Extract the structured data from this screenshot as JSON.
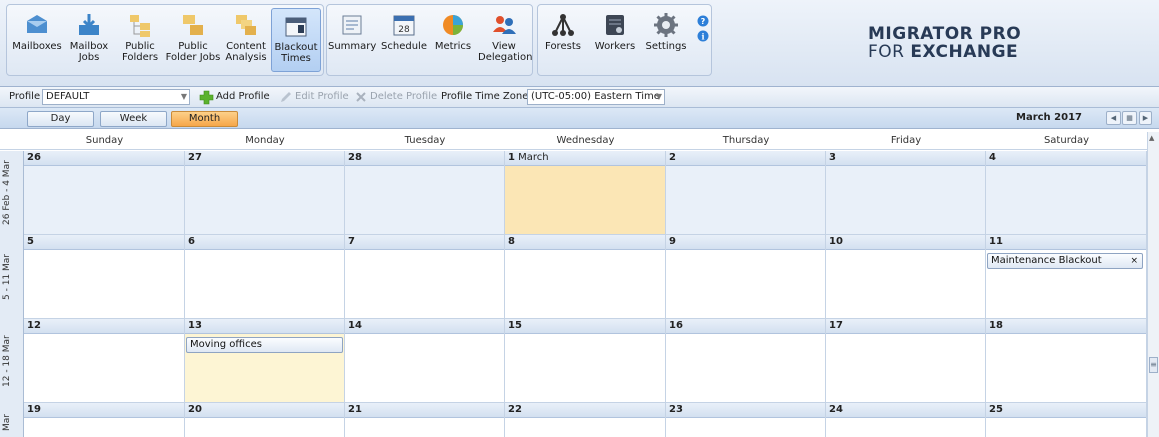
{
  "ribbon": {
    "buttons": [
      {
        "label": "Mailboxes",
        "icon": "mailboxes-icon"
      },
      {
        "label": "Mailbox Jobs",
        "icon": "mailbox-jobs-icon"
      },
      {
        "label": "Public Folders",
        "icon": "public-folders-icon"
      },
      {
        "label": "Public Folder Jobs",
        "icon": "public-folder-jobs-icon"
      },
      {
        "label": "Content Analysis",
        "icon": "content-analysis-icon"
      },
      {
        "label": "Blackout Times",
        "icon": "blackout-times-icon"
      },
      {
        "label": "Summary",
        "icon": "summary-icon"
      },
      {
        "label": "Schedule",
        "icon": "schedule-icon"
      },
      {
        "label": "Metrics",
        "icon": "metrics-icon"
      },
      {
        "label": "View Delegation",
        "icon": "view-delegation-icon"
      },
      {
        "label": "Forests",
        "icon": "forests-icon"
      },
      {
        "label": "Workers",
        "icon": "workers-icon"
      },
      {
        "label": "Settings",
        "icon": "settings-icon"
      }
    ],
    "schedule_day": "28",
    "active_button": "Blackout Times"
  },
  "logo": {
    "line1": "MIGRATOR PRO",
    "line2_a": "FOR ",
    "line2_b": "EXCHANGE"
  },
  "profile_bar": {
    "profile_label": "Profile",
    "profile_value": "DEFAULT",
    "add_label": "Add Profile",
    "edit_label": "Edit Profile",
    "delete_label": "Delete Profile",
    "tz_label": "Profile Time Zone",
    "tz_value": "(UTC-05:00) Eastern Time"
  },
  "view_bar": {
    "day": "Day",
    "week": "Week",
    "month": "Month",
    "active": "Month",
    "current_month": "March 2017"
  },
  "calendar": {
    "weekdays": [
      "Sunday",
      "Monday",
      "Tuesday",
      "Wednesday",
      "Thursday",
      "Friday",
      "Saturday"
    ],
    "weeks": [
      {
        "label": "26 Feb - 4 Mar",
        "days": [
          "26",
          "27",
          "28",
          "1",
          "2",
          "3",
          "4"
        ]
      },
      {
        "label": "5 - 11 Mar",
        "days": [
          "5",
          "6",
          "7",
          "8",
          "9",
          "10",
          "11"
        ]
      },
      {
        "label": "12 - 18 Mar",
        "days": [
          "12",
          "13",
          "14",
          "15",
          "16",
          "17",
          "18"
        ]
      },
      {
        "label": "Mar",
        "days": [
          "19",
          "20",
          "21",
          "22",
          "23",
          "24",
          "25"
        ]
      }
    ],
    "march_first_suffix": "March",
    "appointments": [
      {
        "title": "Maintenance Blackout",
        "close": "×"
      },
      {
        "title": "Moving offices"
      }
    ]
  },
  "colors": {
    "today_highlight": "#fbe6b5",
    "selected_highlight": "#fdf5d4",
    "accent_orange": "#f6a64a"
  }
}
